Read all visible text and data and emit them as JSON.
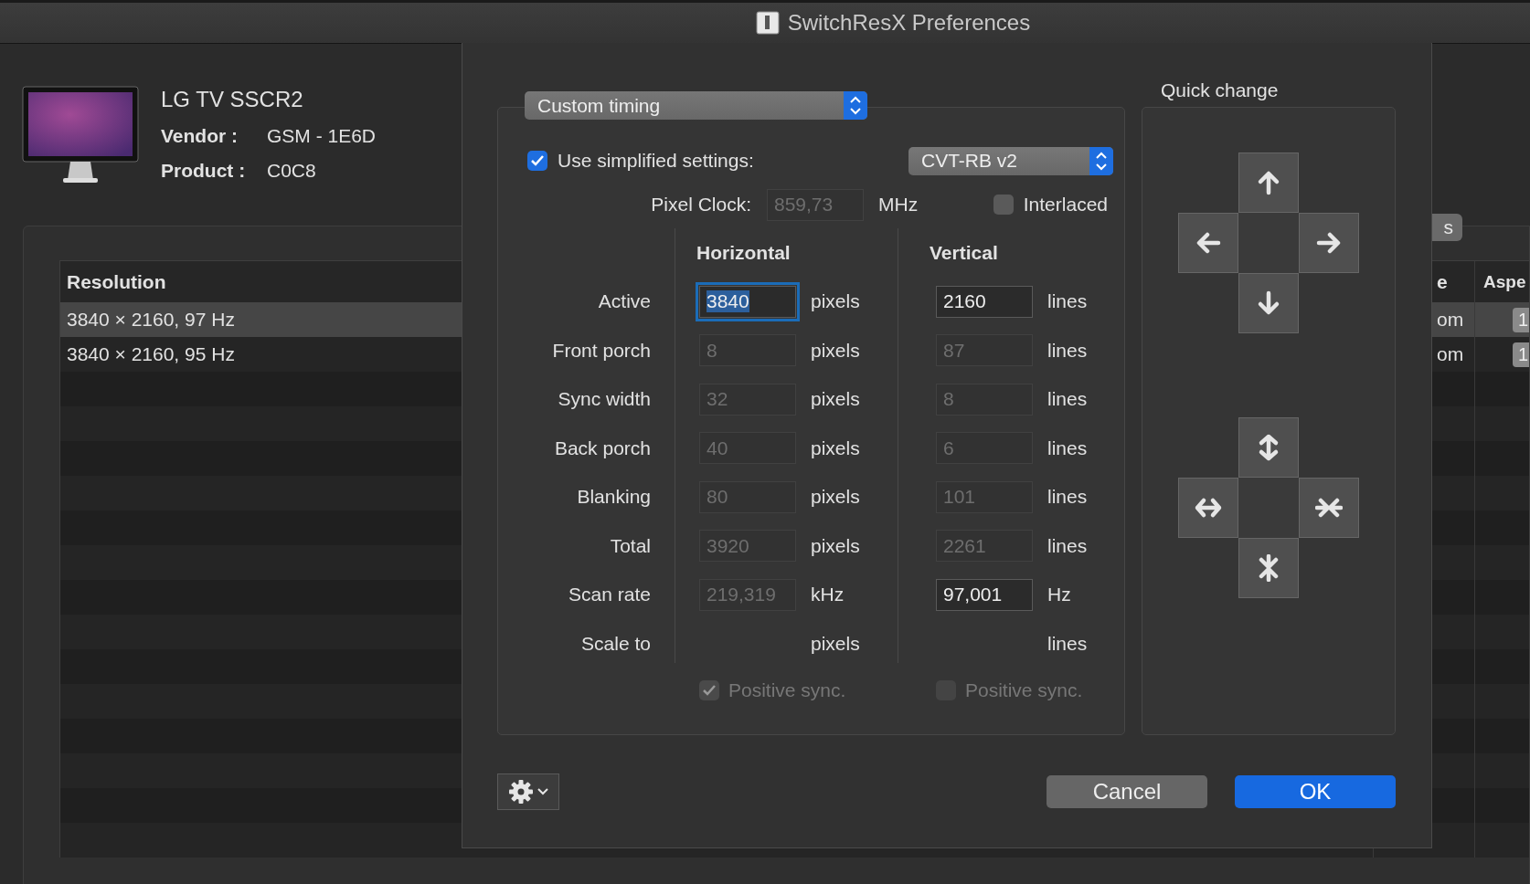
{
  "window": {
    "title": "SwitchResX Preferences"
  },
  "display": {
    "name": "LG TV SSCR2",
    "vendor_label": "Vendor :",
    "vendor": "GSM - 1E6D",
    "product_label": "Product :",
    "product": "C0C8"
  },
  "resolutions": {
    "button": "s",
    "columns": [
      "Resolution",
      "e",
      "Aspe"
    ],
    "rows": [
      {
        "resolution": "3840 × 2160, 97 Hz",
        "column_2": "om",
        "column_3": "1",
        "selected": true
      },
      {
        "resolution": "3840 × 2160, 95 Hz",
        "column_2": "om",
        "column_3": "1",
        "selected": false
      }
    ]
  },
  "sheet": {
    "timing_mode": "Custom timing",
    "simplified": {
      "label": "Use simplified settings:",
      "checked": true
    },
    "standard": "CVT-RB v2",
    "pixel_clock": {
      "label": "Pixel Clock:",
      "value": "859,73",
      "unit": "MHz",
      "enabled": false
    },
    "interlaced": {
      "label": "Interlaced",
      "checked": false
    },
    "headers": [
      "Horizontal",
      "Vertical"
    ],
    "rows": [
      {
        "label": "Active",
        "h": {
          "value": "3840",
          "enabled": true,
          "focused": true
        },
        "h_unit": "pixels",
        "v": {
          "value": "2160",
          "enabled": true,
          "focused": false
        },
        "v_unit": "lines"
      },
      {
        "label": "Front porch",
        "h": {
          "value": "8",
          "enabled": false,
          "focused": false
        },
        "h_unit": "pixels",
        "v": {
          "value": "87",
          "enabled": false,
          "focused": false
        },
        "v_unit": "lines"
      },
      {
        "label": "Sync width",
        "h": {
          "value": "32",
          "enabled": false,
          "focused": false
        },
        "h_unit": "pixels",
        "v": {
          "value": "8",
          "enabled": false,
          "focused": false
        },
        "v_unit": "lines"
      },
      {
        "label": "Back porch",
        "h": {
          "value": "40",
          "enabled": false,
          "focused": false
        },
        "h_unit": "pixels",
        "v": {
          "value": "6",
          "enabled": false,
          "focused": false
        },
        "v_unit": "lines"
      },
      {
        "label": "Blanking",
        "h": {
          "value": "80",
          "enabled": false,
          "focused": false
        },
        "h_unit": "pixels",
        "v": {
          "value": "101",
          "enabled": false,
          "focused": false
        },
        "v_unit": "lines"
      },
      {
        "label": "Total",
        "h": {
          "value": "3920",
          "enabled": false,
          "focused": false
        },
        "h_unit": "pixels",
        "v": {
          "value": "2261",
          "enabled": false,
          "focused": false
        },
        "v_unit": "lines"
      },
      {
        "label": "Scan rate",
        "h": {
          "value": "219,319",
          "enabled": false,
          "focused": false
        },
        "h_unit": "kHz",
        "v": {
          "value": "97,001",
          "enabled": true,
          "focused": false
        },
        "v_unit": "Hz"
      },
      {
        "label": "Scale to",
        "h_unit": "pixels",
        "v_unit": "lines"
      }
    ],
    "positive_sync": [
      {
        "label": "Positive sync.",
        "checked": true,
        "enabled": false
      },
      {
        "label": "Positive sync.",
        "checked": false,
        "enabled": false
      }
    ],
    "quick_change": {
      "label": "Quick change"
    },
    "buttons": [
      {
        "label": "Cancel",
        "primary": false
      },
      {
        "label": "OK",
        "primary": true
      }
    ]
  }
}
